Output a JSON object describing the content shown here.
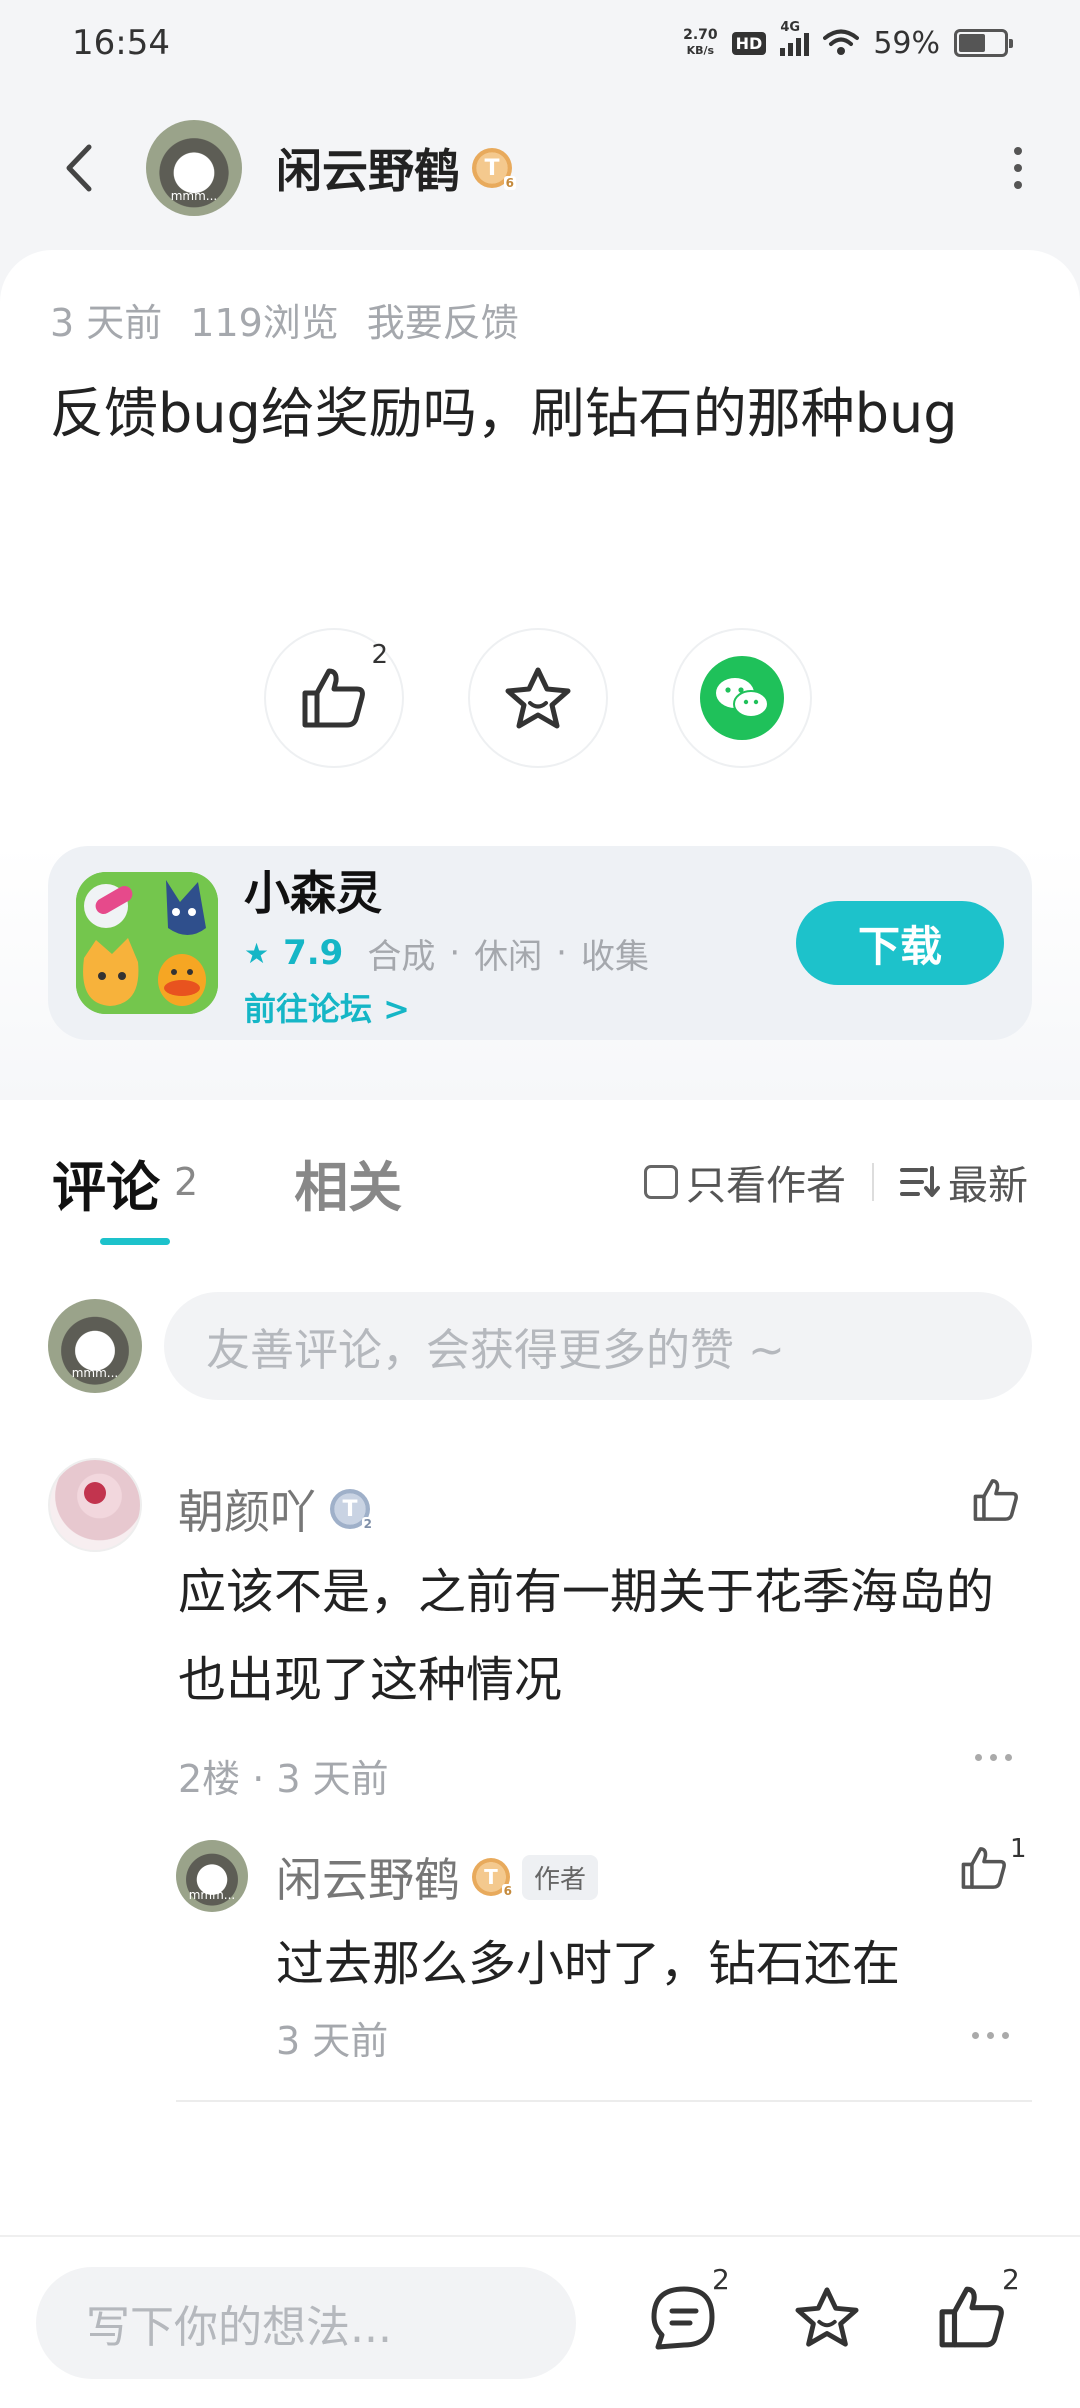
{
  "status_bar": {
    "time": "16:54",
    "net_speed_value": "2.70",
    "net_speed_unit": "KB/s",
    "hd": "HD",
    "network": "4G",
    "battery": "59%"
  },
  "nav": {
    "author_name": "闲云野鹤",
    "author_level": "T",
    "author_level_sub": "6"
  },
  "post": {
    "time_ago": "3 天前",
    "views": "119浏览",
    "feedback_link": "我要反馈",
    "title": "反馈bug给奖励吗，刷钻石的那种bug",
    "like_count": "2"
  },
  "app": {
    "name": "小森灵",
    "score": "7.9",
    "tags": [
      "合成",
      "·",
      "休闲",
      "·",
      "收集"
    ],
    "forum_link": "前往论坛 >",
    "download_label": "下载"
  },
  "comments_section": {
    "tab_comments": "评论",
    "tab_comments_count": "2",
    "tab_related": "相关",
    "filter_author": "只看作者",
    "sort_label": "最新",
    "input_placeholder": "友善评论，会获得更多的赞 ~"
  },
  "comment": {
    "name": "朝颜吖",
    "level": "T",
    "level_sub": "2",
    "body": "应该不是，之前有一期关于花季海岛的也出现了这种情况",
    "meta": "2楼 · 3 天前"
  },
  "reply": {
    "name": "闲云野鹤",
    "level": "T",
    "level_sub": "6",
    "author_tag": "作者",
    "body": "过去那么多小时了，钻石还在",
    "meta": "3 天前",
    "like_count": "1"
  },
  "bottom_bar": {
    "input_placeholder": "写下你的想法...",
    "comment_count": "2",
    "like_count": "2"
  },
  "colors": {
    "accent": "#1dc2cb",
    "wechat": "#1fc15a",
    "gold_badge": "#e8aa5c",
    "silver_badge": "#9fb0c9"
  }
}
